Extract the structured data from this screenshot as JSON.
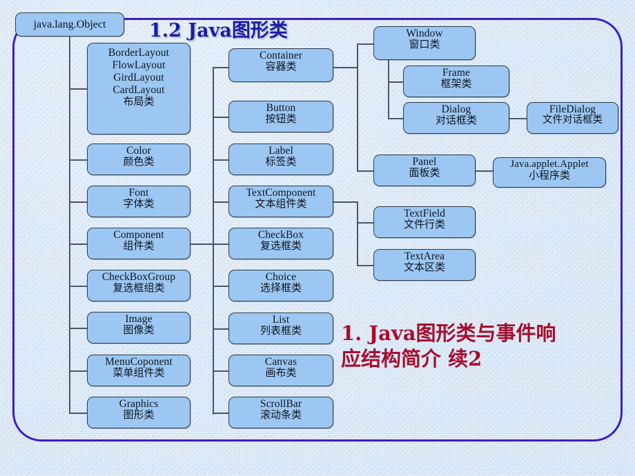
{
  "slide": {
    "title": "1.2  Java图形类",
    "root_node": "java.lang.Object",
    "subtitle_line1": "1. Java图形类与事件响",
    "subtitle_line2": "应结构简介  续2",
    "colors": {
      "frame_border": "#3a1fc4",
      "node_fill": "#9CC7F2",
      "node_border": "#2d3a4a",
      "title_color": "#1c1ca0",
      "subtitle_color": "#a50f2e",
      "connector": "#4a5565",
      "background": "#e6f0fa"
    }
  },
  "columns": {
    "level1": [
      {
        "en": "BorderLayout\nFlowLayout\nGirdLayout\nCardLayout",
        "en_lines": [
          "BorderLayout",
          "FlowLayout",
          "GirdLayout",
          "CardLayout"
        ],
        "cn": "布局类"
      },
      {
        "en": "Color",
        "cn": "颜色类"
      },
      {
        "en": "Font",
        "cn": "字体类"
      },
      {
        "en": "Component",
        "cn": "组件类"
      },
      {
        "en": "CheckBoxGroup",
        "cn": "复选框组类"
      },
      {
        "en": "Image",
        "cn": "图像类"
      },
      {
        "en": "MenuCoponent",
        "cn": "菜单组件类"
      },
      {
        "en": "Graphics",
        "cn": "图形类"
      }
    ],
    "level2": [
      {
        "en": "Container",
        "cn": "容器类"
      },
      {
        "en": "Button",
        "cn": "按钮类"
      },
      {
        "en": "Label",
        "cn": "标签类"
      },
      {
        "en": "TextComponent",
        "cn": "文本组件类"
      },
      {
        "en": "CheckBox",
        "cn": "复选框类"
      },
      {
        "en": "Choice",
        "cn": "选择框类"
      },
      {
        "en": "List",
        "cn": "列表框类"
      },
      {
        "en": "Canvas",
        "cn": "画布类"
      },
      {
        "en": "ScrollBar",
        "cn": "滚动条类"
      }
    ],
    "level3": [
      {
        "en": "Window",
        "cn": "窗口类"
      },
      {
        "en": "Panel",
        "cn": "面板类"
      },
      {
        "en": "TextField",
        "cn": "文件行类"
      },
      {
        "en": "TextArea",
        "cn": "文本区类"
      }
    ],
    "level4": [
      {
        "en": "Frame",
        "cn": "框架类"
      },
      {
        "en": "Dialog",
        "cn": "对话框类"
      },
      {
        "en": "Java.applet.Applet",
        "cn": "小程序类"
      }
    ],
    "level5": [
      {
        "en": "FileDialog",
        "cn": "文件对话框类"
      }
    ]
  }
}
